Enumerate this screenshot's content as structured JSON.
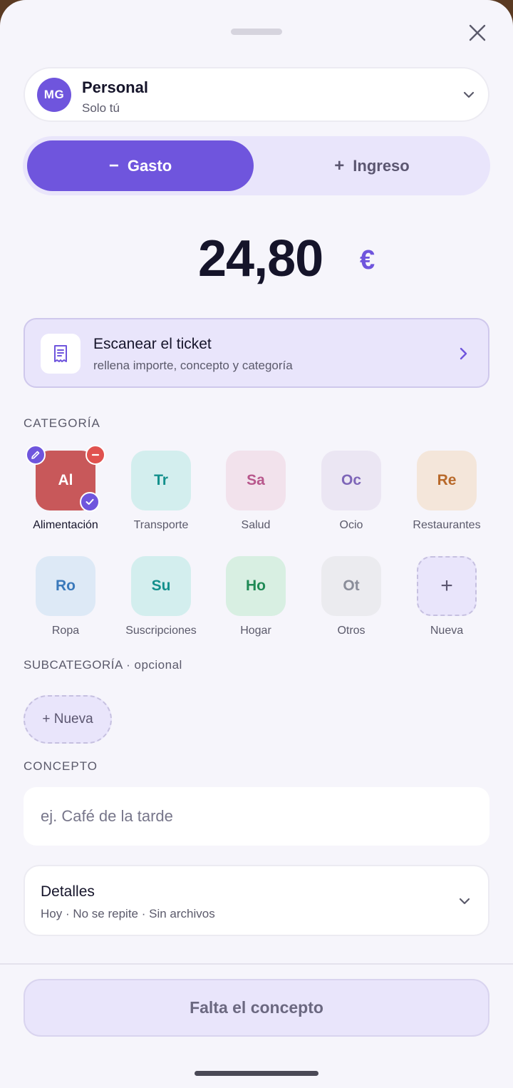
{
  "header": {
    "close_icon": "close-icon"
  },
  "account": {
    "initials": "MG",
    "name": "Personal",
    "subtitle": "Solo tú"
  },
  "type_toggle": {
    "expense": {
      "symbol": "−",
      "label": "Gasto",
      "selected": true
    },
    "income": {
      "symbol": "+",
      "label": "Ingreso",
      "selected": false
    }
  },
  "amount": {
    "value": "24,80",
    "currency": "€"
  },
  "scan": {
    "title": "Escanear el ticket",
    "subtitle": "rellena importe, concepto y categoría"
  },
  "category": {
    "label": "CATEGORÍA",
    "items": [
      {
        "abbr": "Al",
        "label": "Alimentación",
        "bg": "#c8585a",
        "fg": "#ffffff",
        "selected": true
      },
      {
        "abbr": "Tr",
        "label": "Transporte",
        "bg": "#d3eeee",
        "fg": "#13908c"
      },
      {
        "abbr": "Sa",
        "label": "Salud",
        "bg": "#f2e2ec",
        "fg": "#b8578c"
      },
      {
        "abbr": "Oc",
        "label": "Ocio",
        "bg": "#ebe6f3",
        "fg": "#7e66b8"
      },
      {
        "abbr": "Re",
        "label": "Restaurantes",
        "bg": "#f4e6da",
        "fg": "#b8692a"
      },
      {
        "abbr": "Ro",
        "label": "Ropa",
        "bg": "#dde9f6",
        "fg": "#3a79bb"
      },
      {
        "abbr": "Su",
        "label": "Suscripciones",
        "bg": "#d3eeee",
        "fg": "#13908c"
      },
      {
        "abbr": "Ho",
        "label": "Hogar",
        "bg": "#d8efe2",
        "fg": "#1f8a55"
      },
      {
        "abbr": "Ot",
        "label": "Otros",
        "bg": "#ebebef",
        "fg": "#8a8d99"
      }
    ],
    "new": {
      "symbol": "+",
      "label": "Nueva"
    }
  },
  "subcategory": {
    "label": "SUBCATEGORÍA · opcional",
    "new_label": "+ Nueva"
  },
  "concept": {
    "label": "CONCEPTO",
    "placeholder": "ej. Café de la tarde",
    "value": ""
  },
  "details": {
    "title": "Detalles",
    "subtitle": "Hoy · No se repite · Sin archivos"
  },
  "submit": {
    "label": "Falta el concepto"
  }
}
